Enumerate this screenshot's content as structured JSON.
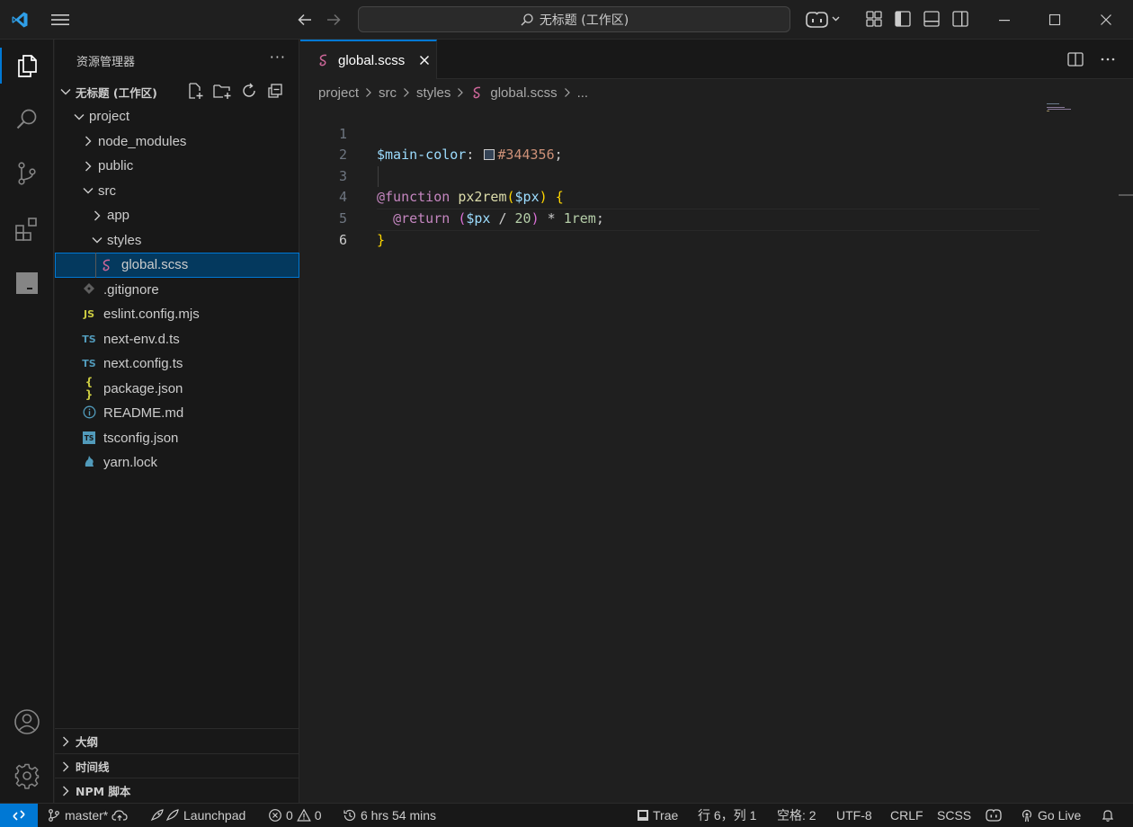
{
  "titlebar": {
    "search_text": "无标题 (工作区)"
  },
  "sidebar": {
    "header": "资源管理器",
    "more": "···",
    "workspace": "无标题 (工作区)",
    "tree": [
      {
        "label": "project",
        "depth": 0,
        "type": "folder-open"
      },
      {
        "label": "node_modules",
        "depth": 1,
        "type": "folder-closed"
      },
      {
        "label": "public",
        "depth": 1,
        "type": "folder-closed"
      },
      {
        "label": "src",
        "depth": 1,
        "type": "folder-open"
      },
      {
        "label": "app",
        "depth": 2,
        "type": "folder-closed"
      },
      {
        "label": "styles",
        "depth": 2,
        "type": "folder-open"
      },
      {
        "label": "global.scss",
        "depth": 3,
        "type": "scss",
        "selected": true
      },
      {
        "label": ".gitignore",
        "depth": 1,
        "type": "git"
      },
      {
        "label": "eslint.config.mjs",
        "depth": 1,
        "type": "js",
        "icon_text": "JS"
      },
      {
        "label": "next-env.d.ts",
        "depth": 1,
        "type": "ts",
        "icon_text": "TS"
      },
      {
        "label": "next.config.ts",
        "depth": 1,
        "type": "ts",
        "icon_text": "TS"
      },
      {
        "label": "package.json",
        "depth": 1,
        "type": "json",
        "icon_text": "{ }"
      },
      {
        "label": "README.md",
        "depth": 1,
        "type": "info"
      },
      {
        "label": "tsconfig.json",
        "depth": 1,
        "type": "tsconfig",
        "icon_text": "TS"
      },
      {
        "label": "yarn.lock",
        "depth": 1,
        "type": "yarn"
      }
    ],
    "sections": [
      "大纲",
      "时间线",
      "NPM 脚本"
    ]
  },
  "editor": {
    "tab_label": "global.scss",
    "breadcrumbs": [
      "project",
      "src",
      "styles",
      "global.scss",
      "..."
    ],
    "line_numbers": [
      "1",
      "2",
      "3",
      "4",
      "5",
      "6"
    ],
    "code": {
      "l1_var": "$main-color",
      "l1_colon": ": ",
      "l1_hex": "#344356",
      "l1_semi": ";",
      "l3_at": "@function",
      "l3_fn": "px2rem",
      "l3_open": "(",
      "l3_param": "$px",
      "l3_close": ")",
      "l3_brace": "{",
      "l4_at": "@return",
      "l4_open": "(",
      "l4_param": "$px",
      "l4_div": " / ",
      "l4_num": "20",
      "l4_close": ")",
      "l4_mul": " * ",
      "l4_unit": "1rem",
      "l4_semi": ";",
      "l5_brace": "}"
    },
    "swatch_color": "#344356"
  },
  "statusbar": {
    "branch": "master*",
    "launchpad": "Launchpad",
    "errors": "0",
    "warnings": "0",
    "time": "6 hrs 54 mins",
    "trae": "Trae",
    "position": "行 6，列 1",
    "spaces": "空格: 2",
    "encoding": "UTF-8",
    "eol": "CRLF",
    "language": "SCSS",
    "golive": "Go Live"
  },
  "colors": {
    "accent": "#0078d4",
    "selection": "#04395e",
    "scss_pink": "#cd6799",
    "js_yellow": "#cbcb41",
    "ts_blue": "#519aba"
  }
}
